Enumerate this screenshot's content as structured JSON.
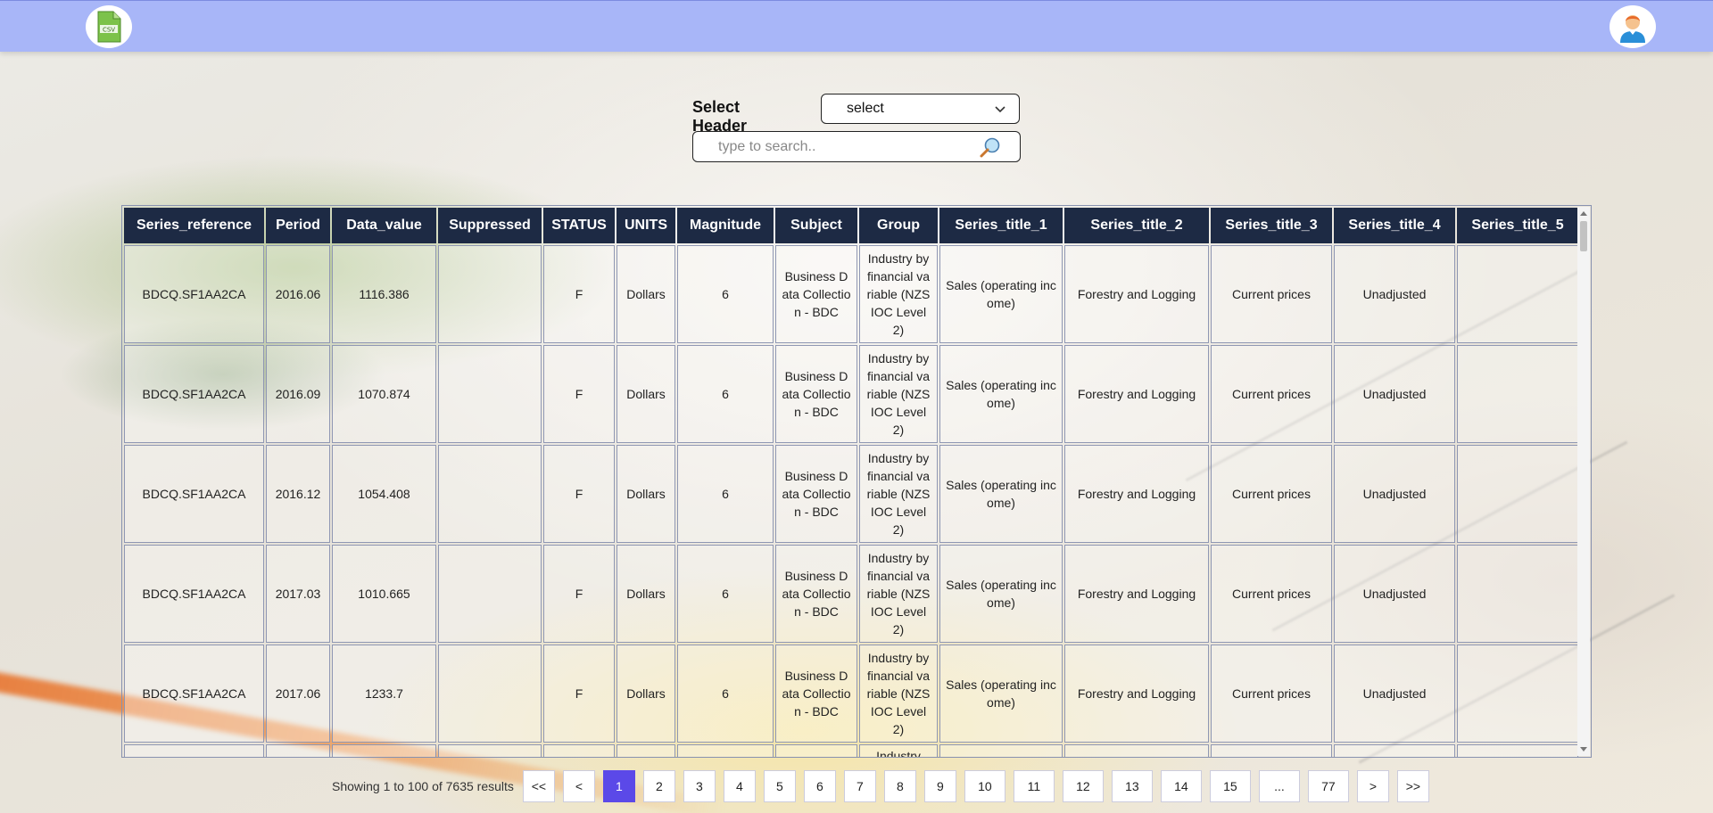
{
  "topbar": {
    "logo_icon": "csv-file-icon",
    "avatar_icon": "user-avatar-icon",
    "bg_color": "#a8b6f8"
  },
  "controls": {
    "select_label": "Select Header :",
    "select_value": "select",
    "search_placeholder": "type to search.."
  },
  "table": {
    "headers": [
      "Series_reference",
      "Period",
      "Data_value",
      "Suppressed",
      "STATUS",
      "UNITS",
      "Magnitude",
      "Subject",
      "Group",
      "Series_title_1",
      "Series_title_2",
      "Series_title_3",
      "Series_title_4",
      "Series_title_5"
    ],
    "rows": [
      [
        "BDCQ.SF1AA2CA",
        "2016.06",
        "1116.386",
        "",
        "F",
        "Dollars",
        "6",
        "Business Data Collection - BDC",
        "Industry by financial variable (NZSIOC Level 2)",
        "Sales (operating income)",
        "Forestry and Logging",
        "Current prices",
        "Unadjusted",
        ""
      ],
      [
        "BDCQ.SF1AA2CA",
        "2016.09",
        "1070.874",
        "",
        "F",
        "Dollars",
        "6",
        "Business Data Collection - BDC",
        "Industry by financial variable (NZSIOC Level 2)",
        "Sales (operating income)",
        "Forestry and Logging",
        "Current prices",
        "Unadjusted",
        ""
      ],
      [
        "BDCQ.SF1AA2CA",
        "2016.12",
        "1054.408",
        "",
        "F",
        "Dollars",
        "6",
        "Business Data Collection - BDC",
        "Industry by financial variable (NZSIOC Level 2)",
        "Sales (operating income)",
        "Forestry and Logging",
        "Current prices",
        "Unadjusted",
        ""
      ],
      [
        "BDCQ.SF1AA2CA",
        "2017.03",
        "1010.665",
        "",
        "F",
        "Dollars",
        "6",
        "Business Data Collection - BDC",
        "Industry by financial variable (NZSIOC Level 2)",
        "Sales (operating income)",
        "Forestry and Logging",
        "Current prices",
        "Unadjusted",
        ""
      ],
      [
        "BDCQ.SF1AA2CA",
        "2017.06",
        "1233.7",
        "",
        "F",
        "Dollars",
        "6",
        "Business Data Collection - BDC",
        "Industry by financial variable (NZSIOC Level 2)",
        "Sales (operating income)",
        "Forestry and Logging",
        "Current prices",
        "Unadjusted",
        ""
      ],
      [
        "",
        "",
        "",
        "",
        "",
        "",
        "",
        "",
        "Industry",
        "",
        "",
        "",
        "",
        ""
      ]
    ]
  },
  "pagination": {
    "info": "Showing 1 to 100 of 7635 results",
    "first": "<<",
    "prev": "<",
    "pages": [
      "1",
      "2",
      "3",
      "4",
      "5",
      "6",
      "7",
      "8",
      "9",
      "10",
      "11",
      "12",
      "13",
      "14",
      "15",
      "...",
      "77"
    ],
    "active_page": "1",
    "next": ">",
    "last": ">>",
    "active_color": "#5b49e8"
  }
}
